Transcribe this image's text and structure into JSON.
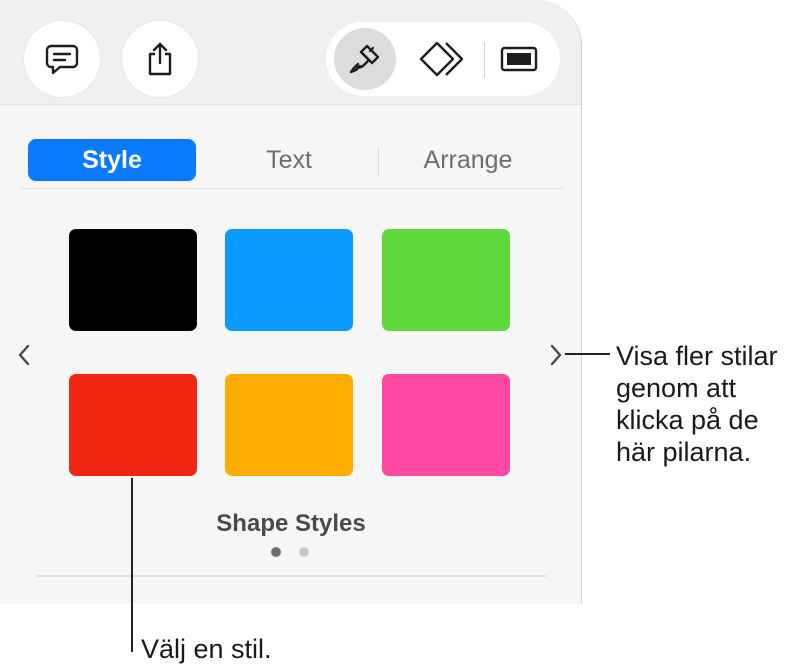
{
  "toolbar": {
    "comment_icon": "comment-icon",
    "share_icon": "share-icon",
    "format_icon": "paintbrush-icon",
    "animate_icon": "animate-icon",
    "document_icon": "document-icon"
  },
  "tabs": [
    {
      "label": "Style",
      "active": true
    },
    {
      "label": "Text",
      "active": false
    },
    {
      "label": "Arrange",
      "active": false
    }
  ],
  "swatches": [
    {
      "color": "#000000"
    },
    {
      "color": "#0a9bff"
    },
    {
      "color": "#5fd83c"
    },
    {
      "color": "#f12613"
    },
    {
      "color": "#fead00"
    },
    {
      "color": "#ff48a2"
    }
  ],
  "section_label": "Shape Styles",
  "page_dots": {
    "count": 2,
    "current": 1
  },
  "callouts": {
    "arrows": "Visa fler stilar genom att klicka på de här pilarna.",
    "arrows_lines": [
      "Visa fler stilar",
      "genom att",
      "klicka på de",
      "här pilarna."
    ],
    "swatch": "Välj en stil."
  },
  "colors": {
    "accent": "#0a7aff"
  }
}
